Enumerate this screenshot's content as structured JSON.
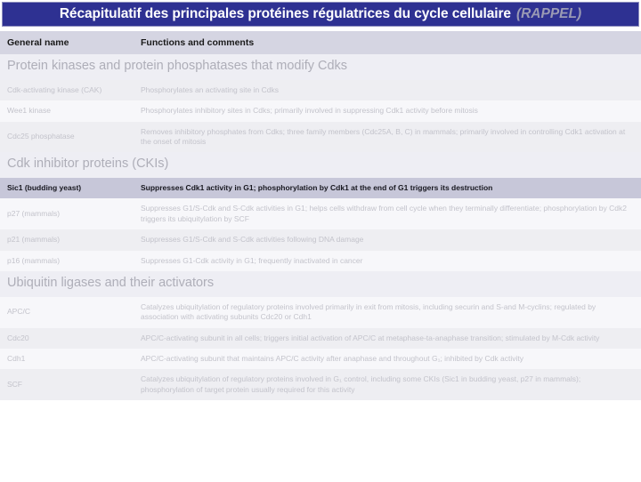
{
  "title": {
    "main": "Récapitulatif des principales protéines régulatrices du cycle cellulaire",
    "suffix": "(RAPPEL)"
  },
  "colors": {
    "title_bar": "#2e3192",
    "title_text": "#ffffff",
    "title_suffix_text": "#9a9ab4",
    "header_row_bg": "#d5d5e2",
    "section_bg": "#eeeef4",
    "section_text": "#aeaeb8",
    "row_shade_bg": "#eeeef2",
    "row_plain_bg": "#f7f7fa",
    "row_text": "#c3c3cb",
    "highlight_row_bg": "#c7c7d9",
    "highlight_row_text": "#17171f"
  },
  "table": {
    "headers": {
      "name": "General name",
      "functions": "Functions and comments"
    },
    "sections": [
      {
        "title": "Protein kinases and protein phosphatases that modify Cdks",
        "rows": [
          {
            "name": "Cdk-activating kinase (CAK)",
            "desc": "Phosphorylates an activating site in Cdks",
            "style": "shade"
          },
          {
            "name": "Wee1 kinase",
            "desc": "Phosphorylates inhibitory sites in Cdks; primarily involved in suppressing Cdk1 activity before mitosis",
            "style": "plain"
          },
          {
            "name": "Cdc25 phosphatase",
            "desc": "Removes inhibitory phosphates from Cdks; three family members (Cdc25A, B, C) in mammals; primarily involved in controlling Cdk1 activation at the onset of mitosis",
            "style": "shade"
          }
        ]
      },
      {
        "title": "Cdk inhibitor proteins (CKIs)",
        "rows": [
          {
            "name": "Sic1 (budding yeast)",
            "desc": "Suppresses Cdk1 activity in G1; phosphorylation by Cdk1 at the end of G1 triggers its destruction",
            "style": "highlight"
          },
          {
            "name": "p27 (mammals)",
            "desc": "Suppresses G1/S-Cdk and S-Cdk activities in G1; helps cells withdraw from cell cycle when they terminally differentiate; phosphorylation by Cdk2 triggers its ubiquitylation by SCF",
            "style": "plain"
          },
          {
            "name": "p21 (mammals)",
            "desc": "Suppresses G1/S-Cdk and S-Cdk activities following DNA damage",
            "style": "shade"
          },
          {
            "name": "p16 (mammals)",
            "desc": "Suppresses G1-Cdk activity in G1; frequently inactivated in cancer",
            "style": "plain"
          }
        ]
      },
      {
        "title": "Ubiquitin ligases and their activators",
        "rows": [
          {
            "name": "APC/C",
            "desc": "Catalyzes ubiquitylation of regulatory proteins involved primarily in exit from mitosis, including securin and S-and M-cyclins; regulated by association with activating subunits Cdc20 or Cdh1",
            "style": "plain"
          },
          {
            "name": "Cdc20",
            "desc": "APC/C-activating subunit in all cells; triggers initial activation of APC/C at metaphase-ta-anaphase transition; stimulated by M-Cdk activity",
            "style": "shade"
          },
          {
            "name": "Cdh1",
            "desc": "APC/C-activating subunit that maintains APC/C activity after anaphase and throughout G₁; inhibited by Cdk activity",
            "style": "plain"
          },
          {
            "name": "SCF",
            "desc": "Catalyzes ubiquitylation of regulatory proteins involved in G₁ control, including some CKIs (Sic1 in budding yeast, p27 in mammals); phosphorylation of target protein usually required for this activity",
            "style": "shade"
          }
        ]
      }
    ]
  }
}
